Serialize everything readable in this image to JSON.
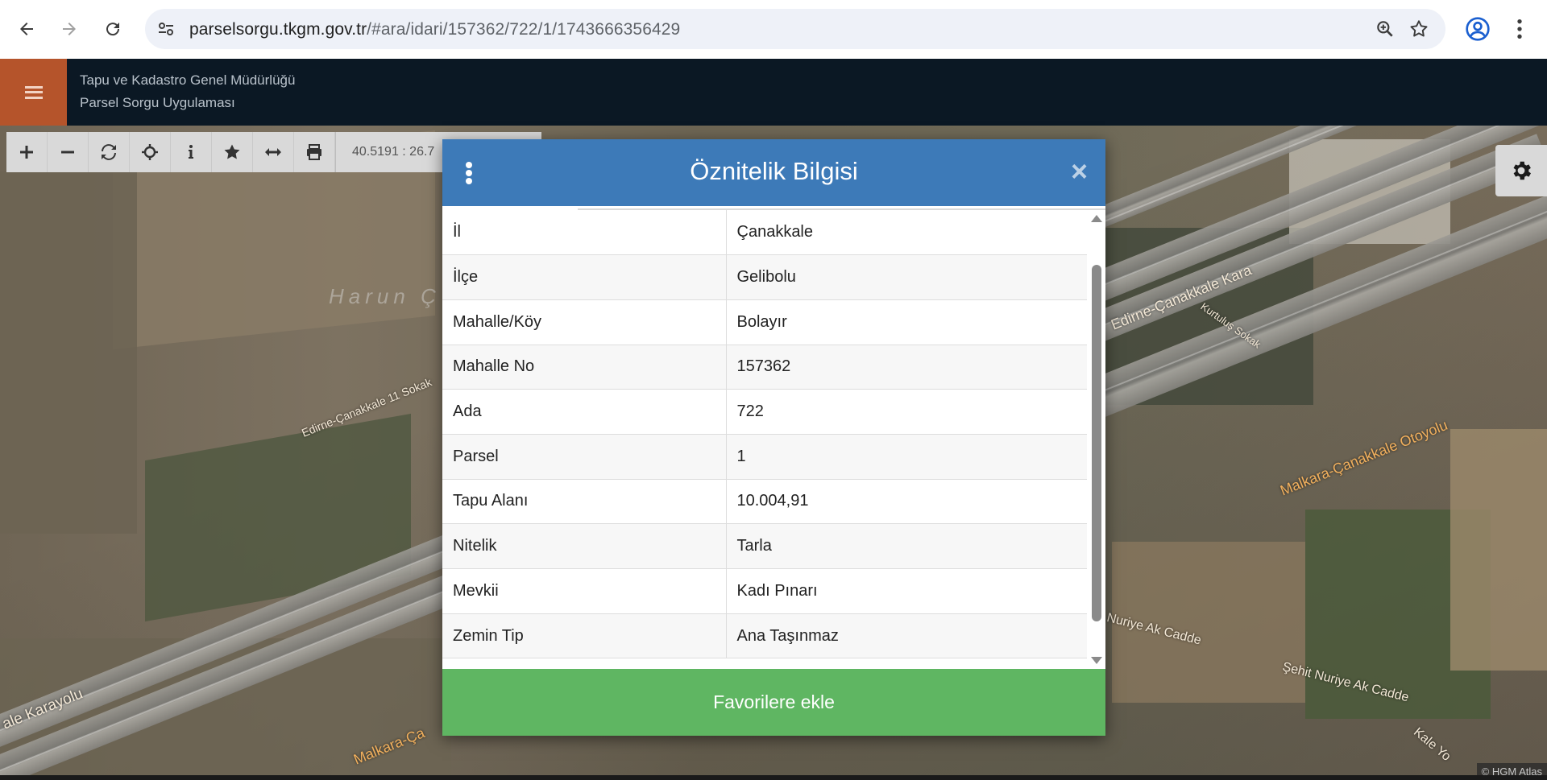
{
  "browser": {
    "url_host": "parselsorgu.tkgm.gov.tr",
    "url_path": "/#ara/idari/157362/722/1/1743666356429",
    "icons": [
      "back-arrow-icon",
      "forward-arrow-icon",
      "reload-icon",
      "site-settings-icon",
      "zoom-icon",
      "bookmark-star-icon",
      "profile-icon",
      "menu-dots-icon"
    ]
  },
  "app": {
    "title_line1": "Tapu ve Kadastro Genel Müdürlüğü",
    "title_line2": "Parsel Sorgu Uygulaması",
    "accent_color": "#b5542b",
    "header_color": "#0b1824"
  },
  "toolbar": {
    "tools": [
      "zoom-in-icon",
      "zoom-out-icon",
      "refresh-icon",
      "locate-icon",
      "info-icon",
      "favorite-star-icon",
      "measure-icon",
      "print-icon"
    ],
    "coordinates": "40.5191 : 26.7"
  },
  "map": {
    "labels": {
      "harun": "Harun Ç",
      "edirne_sokak": "Edirne-Çanakkale 11 Sokak",
      "edirne_kara": "Edirne-Çanakkale Kara",
      "kurtulus": "Kurtuluş Sokak",
      "malkara_otoyolu": "Malkara-Çanakkale Otoyolu",
      "nuriye": "Nuriye Ak Cadde",
      "sehit_nuriye": "Şehit Nuriye Ak Cadde",
      "karayolu": "ale Karayolu",
      "malkara_bottom": "Malkara-Ça",
      "kale_yolu": "Kale Yo"
    },
    "attribution": "© HGM Atlas"
  },
  "modal": {
    "title": "Öznitelik Bilgisi",
    "close_label": "×",
    "header_color": "#3d7ab8",
    "rows": [
      {
        "key": "İl",
        "value": "Çanakkale"
      },
      {
        "key": "İlçe",
        "value": "Gelibolu"
      },
      {
        "key": "Mahalle/Köy",
        "value": "Bolayır"
      },
      {
        "key": "Mahalle No",
        "value": "157362"
      },
      {
        "key": "Ada",
        "value": "722"
      },
      {
        "key": "Parsel",
        "value": "1"
      },
      {
        "key": "Tapu Alanı",
        "value": "10.004,91"
      },
      {
        "key": "Nitelik",
        "value": "Tarla"
      },
      {
        "key": "Mevkii",
        "value": "Kadı Pınarı"
      },
      {
        "key": "Zemin Tip",
        "value": "Ana Taşınmaz"
      }
    ],
    "favorite_button": "Favorilere ekle",
    "favorite_color": "#5fb662"
  }
}
